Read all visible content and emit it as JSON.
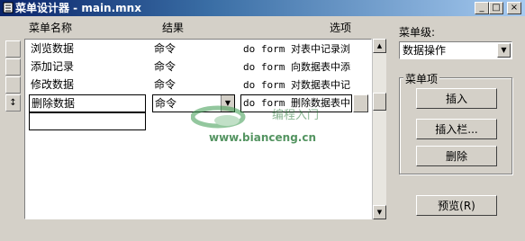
{
  "window": {
    "title": "菜单设计器 - main.mnx",
    "min_label": "_",
    "max_label": "□",
    "close_label": "×"
  },
  "grid": {
    "headers": {
      "name": "菜单名称",
      "result": "结果",
      "options": "选项"
    },
    "rows": [
      {
        "name": "浏览数据",
        "result": "命令",
        "options": "do form 对表中记录浏"
      },
      {
        "name": "添加记录",
        "result": "命令",
        "options": "do form 向数据表中添"
      },
      {
        "name": "修改数据",
        "result": "命令",
        "options": "do form 对数据表中记"
      },
      {
        "name": "删除数据",
        "result": "命令",
        "options": "do form 删除数据表中"
      }
    ],
    "current_row_marker": "↕"
  },
  "right_panel": {
    "menu_level_label": "菜单级:",
    "menu_level_value": "数据操作",
    "group_label": "菜单项",
    "insert_button": "插入",
    "insert_bar_button": "插入栏...",
    "delete_button": "删除",
    "preview_button": "预览(R)"
  },
  "watermark": {
    "text": "www.bianceng.cn"
  },
  "colors": {
    "title_start": "#0a246a",
    "title_end": "#a6caf0",
    "face": "#d4d0c8"
  }
}
